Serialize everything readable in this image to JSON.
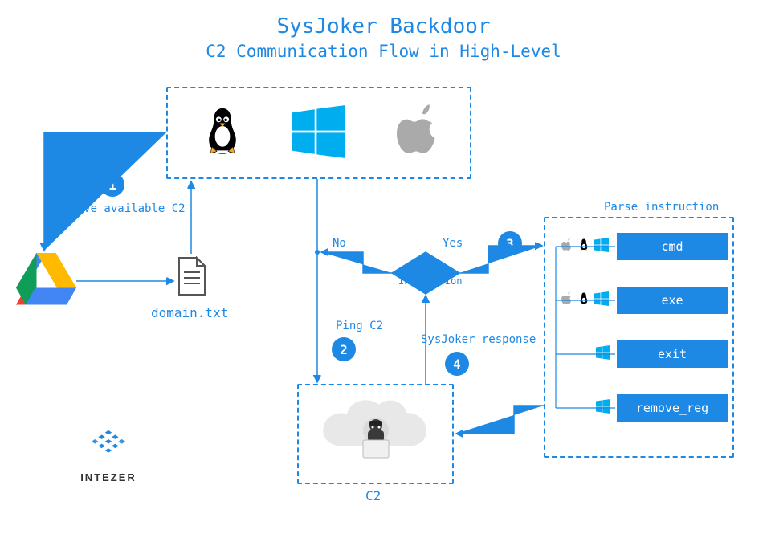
{
  "title": "SysJoker Backdoor",
  "subtitle": "C2 Communication Flow in High-Level",
  "steps": {
    "s1": {
      "num": "1",
      "label": "Resolve available C2"
    },
    "s2": {
      "num": "2",
      "label": "Ping C2"
    },
    "s3": {
      "num": "3",
      "label": ""
    },
    "s4": {
      "num": "4",
      "label": "SysJoker response"
    }
  },
  "decision": {
    "text": "C2 Instruction",
    "yes": "Yes",
    "no": "No"
  },
  "parse_title": "Parse instruction",
  "commands": {
    "cmd": "cmd",
    "exe": "exe",
    "exit": "exit",
    "remove_reg": "remove_reg"
  },
  "domain_file": "domain.txt",
  "c2_label": "C2",
  "logo": "INTEZER",
  "os_icons": {
    "linux": "linux-icon",
    "windows": "windows-icon",
    "apple": "apple-icon"
  }
}
